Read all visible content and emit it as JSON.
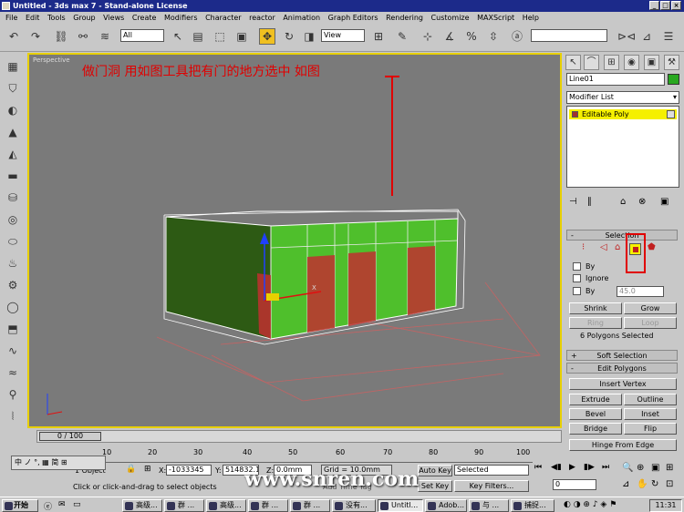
{
  "window": {
    "title": "Untitled - 3ds max 7 - Stand-alone License"
  },
  "menu": [
    "File",
    "Edit",
    "Tools",
    "Group",
    "Views",
    "Create",
    "Modifiers",
    "Character",
    "reactor",
    "Animation",
    "Graph Editors",
    "Rendering",
    "Customize",
    "MAXScript",
    "Help"
  ],
  "toolbar": {
    "selection_filter": "All",
    "ref_coord": "View"
  },
  "viewport": {
    "label": "Perspective",
    "annotation": "做门洞 用如图工具把有门的地方选中   如图"
  },
  "command_panel": {
    "object_name": "Line01",
    "object_color": "#28a820",
    "modifier_list": "Modifier List",
    "stack_item": "Editable Poly",
    "selection": {
      "title": "Selection",
      "by_vertex": "By",
      "ignore_backfacing": "Ignore",
      "by_angle": "By",
      "angle_value": "45.0",
      "shrink": "Shrink",
      "grow": "Grow",
      "ring": "Ring",
      "loop": "Loop",
      "status": "6 Polygons Selected"
    },
    "soft_selection": "Soft Selection",
    "edit_polygons": {
      "title": "Edit Polygons",
      "insert_vertex": "Insert Vertex",
      "extrude": "Extrude",
      "outline": "Outline",
      "bevel": "Bevel",
      "inset": "Inset",
      "bridge": "Bridge",
      "flip": "Flip",
      "hinge": "Hinge From Edge"
    }
  },
  "timeline": {
    "frame": "0 / 100",
    "ticks": [
      "10",
      "20",
      "30",
      "40",
      "50",
      "60",
      "70",
      "80",
      "90",
      "100"
    ]
  },
  "status": {
    "objects": "1 Object",
    "prompt": "Click or click-and-drag to select objects",
    "x_label": "X:",
    "x_value": "-1033345",
    "y_label": "Y:",
    "y_value": "514832.1",
    "z_label": "Z:",
    "z_value": "0.0mm",
    "grid": "Grid = 10.0mm",
    "add_time_tag": "Add Time Tag",
    "auto_key": "Auto Key",
    "set_key": "Set Key",
    "key_mode": "Selected",
    "key_filters": "Key Filters...",
    "current_frame": "0"
  },
  "ime": "中 ノ °, ▦ 简 ⊞",
  "watermark": "www.snren.com",
  "taskbar": {
    "start": "开始",
    "tasks": [
      "高级...",
      "群 ...",
      "高级...",
      "群 ...",
      "群 ...",
      "没有...",
      "Untitl...",
      "Adob...",
      "与 ...",
      "捕捉..."
    ],
    "clock": "11:31"
  },
  "colors": {
    "accent_selected": "#e8d000",
    "wall_green": "#44bb22",
    "selected_red": "#c03030"
  }
}
